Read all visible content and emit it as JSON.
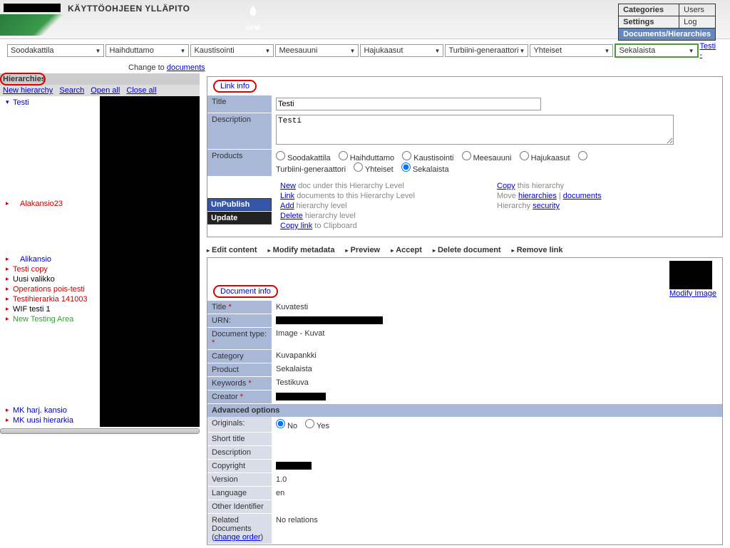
{
  "header": {
    "title": "KÄYTTÖOHJEEN YLLÄPITO",
    "logo_text": "UPM"
  },
  "nav": {
    "r1c1": "Categories",
    "r1c2": "Users",
    "r2c1": "Settings",
    "r2c2": "Log",
    "r3": "Documents/Hierarchies"
  },
  "dropdowns": [
    "Soodakattila",
    "Haihduttamo",
    "Kaustisointi",
    "Meesauuni",
    "Hajukaasut",
    "Turbiini-generaattori",
    "Yhteiset",
    "Sekalaista"
  ],
  "testi_link": "Testi -",
  "change_link_prefix": "Change to ",
  "change_link": "documents",
  "sidebar": {
    "header": "Hierarchies",
    "links": [
      "New hierarchy",
      "Search",
      "Open all",
      "Close all"
    ]
  },
  "tree": {
    "root": "Testi",
    "i1": "Alakansio23",
    "i2": "Alikansio",
    "i3": "Testi copy",
    "i4": "Uusi valikko",
    "i5": "Operations pois-testi",
    "i6": "Testihierarkia 141003",
    "i7": "WIF testi 1",
    "i8": "New Testing Area",
    "i9": "MK harj. kansio",
    "i10": "MK uusi hierarkia"
  },
  "link_info": {
    "panel_title": "Link info",
    "title_label": "Title",
    "title_value": "Testi",
    "desc_label": "Description",
    "desc_value": "Testi",
    "products_label": "Products",
    "products": [
      "Soodakattila",
      "Haihduttamo",
      "Kaustisointi",
      "Meesauuni",
      "Hajukaasut",
      "Turbiini-generaattori",
      "Yhteiset",
      "Sekalaista"
    ],
    "btn_unpublish": "UnPublish",
    "btn_update": "Update"
  },
  "actions": {
    "new": "New",
    "new_txt": " doc under this Hierarchy Level",
    "link": "Link",
    "link_txt": " documents to this Hierarchy Level",
    "add": "Add",
    "add_txt": " hierarchy level",
    "delete": "Delete",
    "delete_txt": " hierarchy level",
    "copylink": "Copy link",
    "copylink_txt": " to Clipboard",
    "copy": "Copy",
    "copy_txt": " this hierarchy",
    "move": "Move ",
    "hierarchies": "hierarchies",
    "sep": "  |  ",
    "documents": "documents",
    "hsec": "Hierarchy ",
    "security": "security"
  },
  "toolbar": [
    "Edit content",
    "Modify metadata",
    "Preview",
    "Accept",
    "Delete document",
    "Remove link"
  ],
  "doc_info": {
    "panel_title": "Document info",
    "modify_image": "Modify Image",
    "title_label": "Title ",
    "title_value": "Kuvatesti",
    "urn_label": "URN:",
    "doctype_label": "Document type: ",
    "doctype_value": "Image - Kuvat",
    "category_label": "Category",
    "category_value": "Kuvapankki",
    "product_label": "Product",
    "product_value": "Sekalaista",
    "keywords_label": "Keywords ",
    "keywords_value": "Testikuva",
    "creator_label": "Creator ",
    "adv_header": "Advanced options",
    "originals_label": "Originals:",
    "no": "No",
    "yes": "Yes",
    "shorttitle_label": "Short title",
    "desc_label": "Description",
    "copyright_label": "Copyright",
    "version_label": "Version",
    "version_value": "1.0",
    "language_label": "Language",
    "language_value": "en",
    "otherid_label": "Other Identifier",
    "related_label": "Related Documents",
    "related_value": "No relations",
    "change_order": "change order"
  }
}
